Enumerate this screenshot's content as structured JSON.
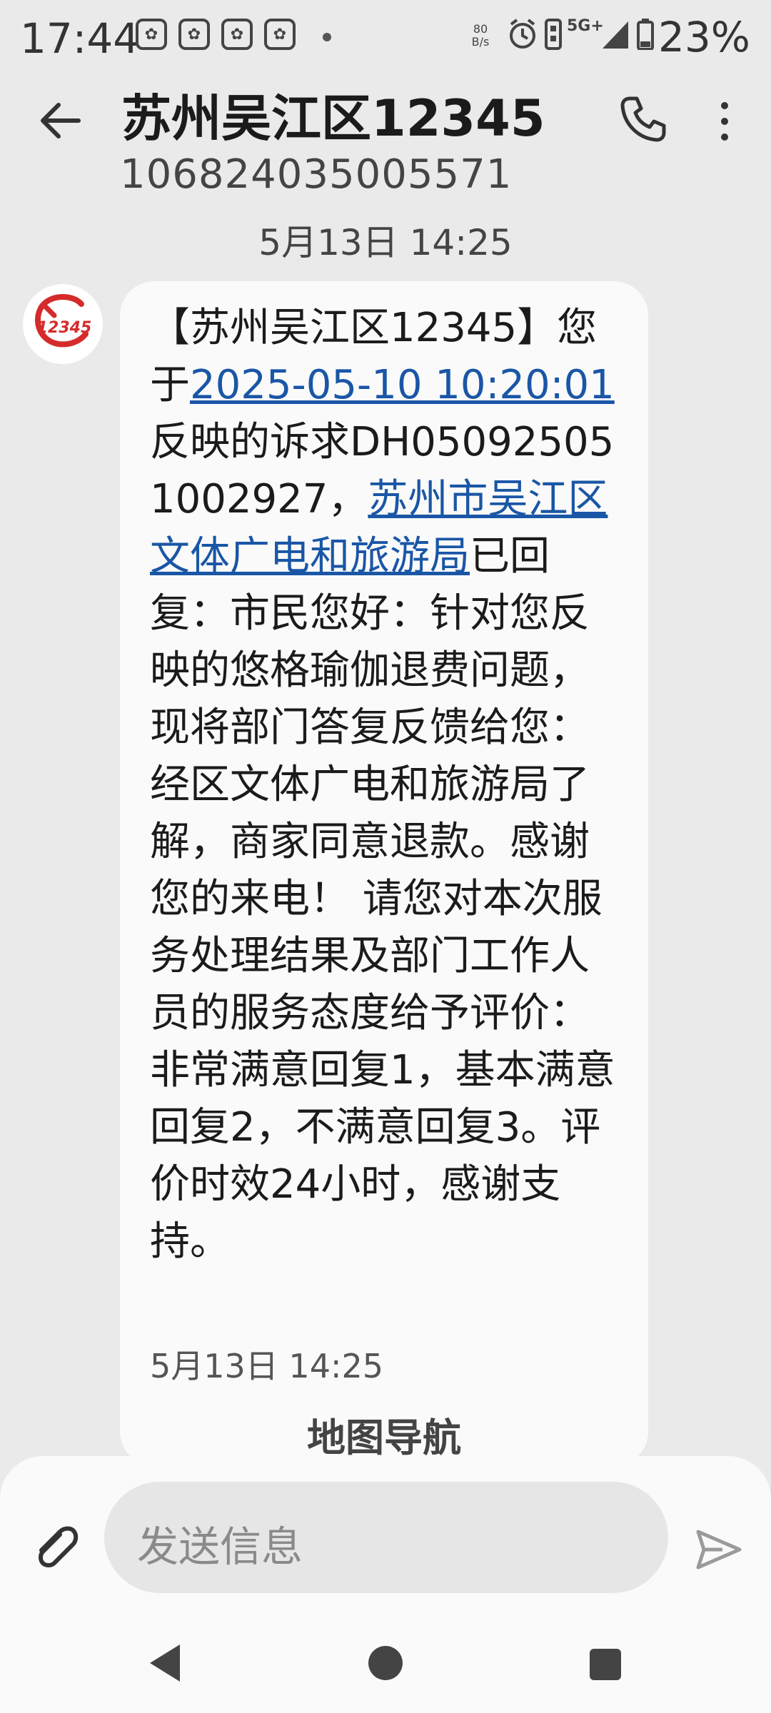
{
  "status_bar": {
    "time": "17:44",
    "net_speed_value": "80",
    "net_speed_unit": "B/s",
    "network": "5G+",
    "battery_percent": "23%",
    "icons": [
      "paw-icon",
      "paw-icon",
      "paw-icon",
      "paw-icon",
      "alarm-icon",
      "vibrate-icon",
      "signal-icon",
      "battery-icon"
    ]
  },
  "header": {
    "title": "苏州吴江区12345",
    "number": "106824035005571"
  },
  "date_header": "5月13日 14:25",
  "message": {
    "text_1": "【苏州吴江区12345】您于",
    "link_datetime": "2025-05-10 10:20:01",
    "text_2": "反映的诉求DH050925051002927，",
    "link_department": "苏州市吴江区文体广电和旅游局",
    "text_3": "已回复：市民您好：针对您反映的悠格瑜伽退费问题，现将部门答复反馈给您：经区文体广电和旅游局了解，商家同意退款。感谢您的来电！ 请您对本次服务处理结果及部门工作人员的服务态度给予评价：非常满意回复1，基本满意回复2，不满意回复3。评价时效24小时，感谢支持。",
    "time": "5月13日 14:25",
    "action": "地图导航"
  },
  "composer": {
    "placeholder": "发送信息"
  },
  "colors": {
    "link": "#1a56a6",
    "bubble": "#fafafa",
    "background": "#eaeaea",
    "avatar_red": "#d62b2b"
  }
}
